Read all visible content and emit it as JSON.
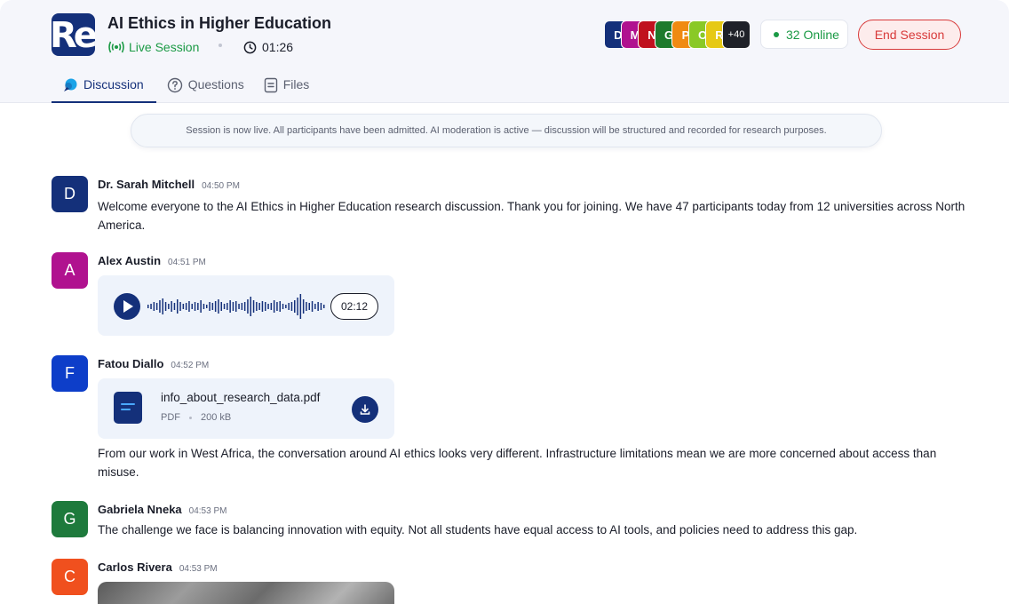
{
  "header": {
    "logo_text": "Re",
    "title": "AI Ethics in Higher Education",
    "live_label": "Live Session",
    "timer": "01:26",
    "participants": [
      {
        "initial": "D",
        "color": "#14307a"
      },
      {
        "initial": "M",
        "color": "#b0128f"
      },
      {
        "initial": "N",
        "color": "#c0111e"
      },
      {
        "initial": "G",
        "color": "#1e7a2c"
      },
      {
        "initial": "P",
        "color": "#f08a12"
      },
      {
        "initial": "O",
        "color": "#8ac926"
      },
      {
        "initial": "R",
        "color": "#e6c915"
      }
    ],
    "more_count": "+40",
    "online_label": "32 Online",
    "end_button": "End Session"
  },
  "tabs": [
    {
      "label": "Discussion",
      "active": true
    },
    {
      "label": "Questions",
      "active": false
    },
    {
      "label": "Files",
      "active": false
    }
  ],
  "banner": "Session is now live. All participants have been admitted. AI moderation is active — discussion will be structured and recorded for research purposes.",
  "messages": [
    {
      "initial": "D",
      "color": "#14307a",
      "name": "Dr. Sarah Mitchell",
      "time": "04:50 PM",
      "text": "Welcome everyone to the AI Ethics in Higher Education research discussion. Thank you for joining. We have 47 participants today from 12 universities across North America."
    },
    {
      "initial": "A",
      "color": "#b0128f",
      "name": "Alex Austin",
      "time": "04:51 PM",
      "voice_duration": "02:12"
    },
    {
      "initial": "F",
      "color": "#0d3ec9",
      "name": "Fatou Diallo",
      "time": "04:52 PM",
      "file": {
        "name": "info_about_research_data.pdf",
        "type": "PDF",
        "size": "200 kB"
      },
      "text": "From our work in West Africa, the conversation around AI ethics looks very different. Infrastructure limitations mean we are more concerned about access than misuse."
    },
    {
      "initial": "G",
      "color": "#1e7a3c",
      "name": "Gabriela Nneka",
      "time": "04:53 PM",
      "text": "The challenge we face is balancing innovation with equity. Not all students have equal access to AI tools, and policies need to address this gap."
    },
    {
      "initial": "C",
      "color": "#f0501e",
      "name": "Carlos Rivera",
      "time": "04:53 PM"
    }
  ]
}
